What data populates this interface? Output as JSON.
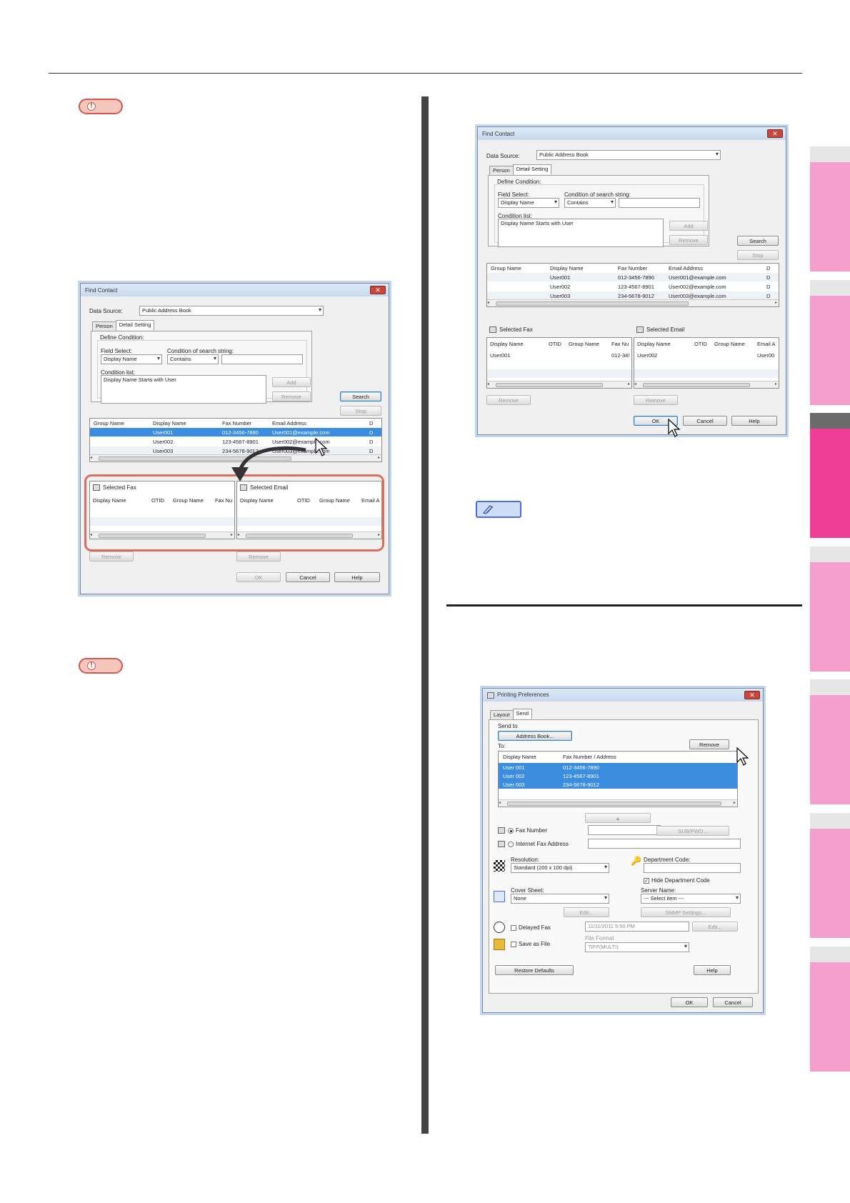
{
  "colors": {
    "note_red": "#d2574f",
    "memo_blue": "#4a6fd1",
    "tab_pink": "#f59fcc",
    "tab_active": "#ee3e96",
    "highlight": "#d9705f",
    "selection": "#3b8de0"
  },
  "icons": {
    "note": "exclamation-icon",
    "memo": "pencil-icon",
    "cursor": "arrow-cursor-icon"
  },
  "note_badge": {
    "symbol": "!"
  },
  "dialog1": {
    "title": "Find Contact",
    "data_source_label": "Data Source:",
    "data_source_value": "Public Address Book",
    "tabs": [
      "Person",
      "Detail Setting"
    ],
    "define_condition": "Define Condition:",
    "field_select_label": "Field Select:",
    "field_select_value": "Display Name",
    "condition_label": "Condition of search string:",
    "condition_value": "Contains",
    "condition_list_label": "Condition list:",
    "condition_list_value": "Display Name Starts with User",
    "add": "Add",
    "remove": "Remove",
    "search": "Search",
    "stop": "Stop",
    "columns": [
      "Group Name",
      "Display Name",
      "Fax Number",
      "Email Address",
      "D"
    ],
    "rows": [
      [
        "",
        "User001",
        "012-3456-7890",
        "User001@example.com",
        "D"
      ],
      [
        "",
        "User002",
        "123-4567-8901",
        "User002@example.com",
        "D"
      ],
      [
        "",
        "User003",
        "234-5678-9012",
        "User003@example.com",
        "D"
      ]
    ],
    "selected_fax": "Selected Fax",
    "selected_email": "Selected Email",
    "fax_columns": [
      "Display Name",
      "OTID",
      "Group Name",
      "Fax Nu"
    ],
    "email_columns": [
      "Display Name",
      "OTID",
      "Group Name",
      "Email A"
    ],
    "ok": "OK",
    "cancel": "Cancel",
    "help": "Help"
  },
  "dialog2": {
    "title": "Find Contact",
    "data_source_label": "Data Source:",
    "data_source_value": "Public Address Book",
    "tabs": [
      "Person",
      "Detail Setting"
    ],
    "define_condition": "Define Condition:",
    "field_select_label": "Field Select:",
    "field_select_value": "Display Name",
    "condition_label": "Condition of search string:",
    "condition_value": "Contains",
    "condition_list_label": "Condition list:",
    "condition_list_value": "Display Name Starts with User",
    "add": "Add",
    "remove": "Remove",
    "search": "Search",
    "stop": "Stop",
    "columns": [
      "Group Name",
      "Display Name",
      "Fax Number",
      "Email Address",
      "D"
    ],
    "rows": [
      [
        "",
        "User001",
        "012-3456-7890",
        "User001@example.com",
        "D"
      ],
      [
        "",
        "User002",
        "123-4567-8901",
        "User002@example.com",
        "D"
      ],
      [
        "",
        "User003",
        "234-5678-9012",
        "User003@example.com",
        "D"
      ]
    ],
    "selected_fax": "Selected Fax",
    "selected_email": "Selected Email",
    "fax_columns": [
      "Display Name",
      "OTID",
      "Group Name",
      "Fax Nu"
    ],
    "email_columns": [
      "Display Name",
      "OTID",
      "Group Name",
      "Email A"
    ],
    "fax_row": [
      "User001",
      "",
      "",
      "012-34!"
    ],
    "email_row": [
      "User002",
      "",
      "",
      "User00"
    ],
    "ok": "OK",
    "cancel": "Cancel",
    "help": "Help"
  },
  "dialog3": {
    "title": "Printing Preferences",
    "tabs": [
      "Layout",
      "Send"
    ],
    "send_to": "Send to",
    "address_book": "Address Book...",
    "to": "To:",
    "remove": "Remove",
    "columns": [
      "Display Name",
      "Fax Number / Address"
    ],
    "rows": [
      [
        "User 001",
        "012-3456-7890"
      ],
      [
        "User 002",
        "123-4567-8901"
      ],
      [
        "User 003",
        "234-5678-9012"
      ]
    ],
    "fax_number": "Fax Number",
    "sub_pwd": "SUB/PWD...",
    "internet_fax": "Internet Fax Address",
    "resolution_label": "Resolution:",
    "resolution_value": "Standard (200 x 100 dpi)",
    "department_code": "Department Code:",
    "hide_department_code": "Hide Department Code",
    "cover_sheet_label": "Cover Sheet:",
    "cover_sheet_value": "None",
    "edit": "Edit...",
    "server_name_label": "Server Name:",
    "server_name_value": "--- Select item ---",
    "snmp_settings": "SNMP Settings...",
    "delayed_fax": "Delayed Fax",
    "delayed_value": "11/11/2011 5:50 PM",
    "save_as_file": "Save as File",
    "file_format_label": "File Format",
    "file_format_value": "TIFF(MULTI)",
    "restore_defaults": "Restore Defaults",
    "help": "Help",
    "ok": "OK",
    "cancel": "Cancel"
  }
}
